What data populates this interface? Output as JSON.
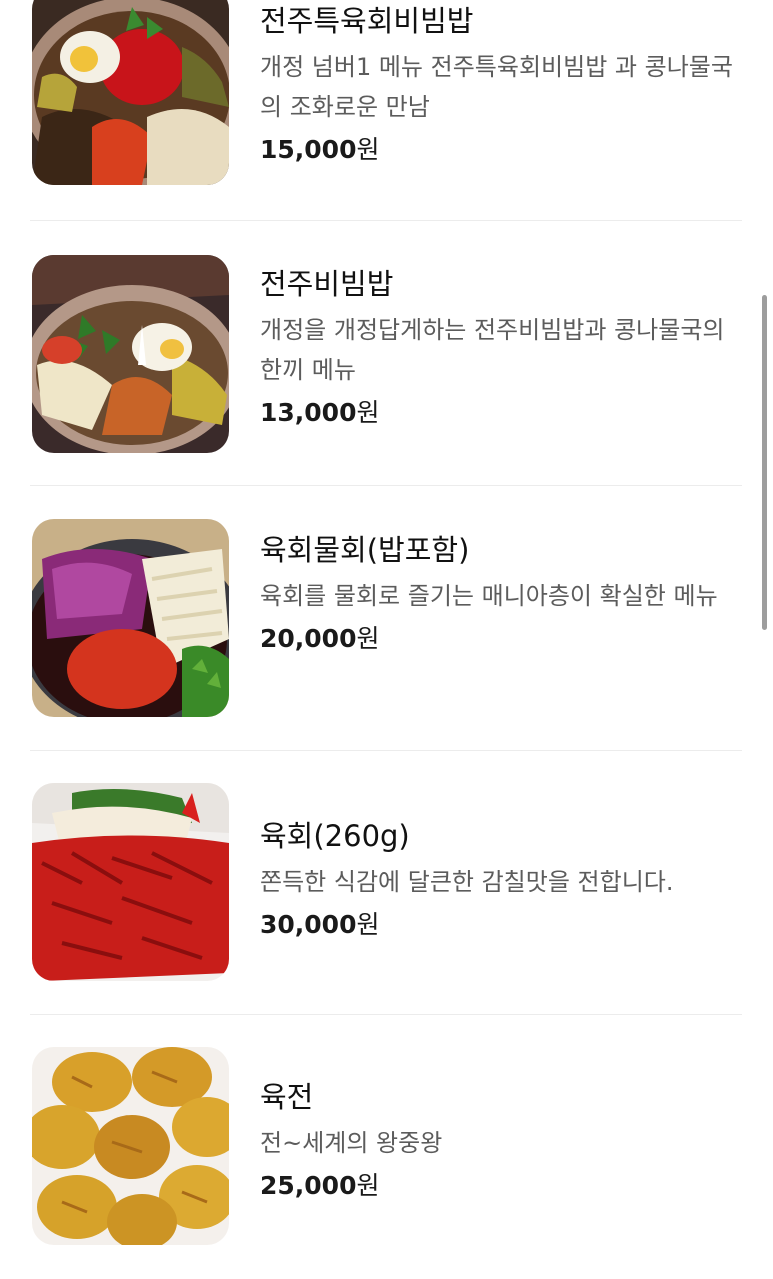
{
  "menu": {
    "items": [
      {
        "name": "전주특육회비빔밥",
        "description": "개정 넘버1 메뉴 전주특육회비빔밥 과 콩나물국의 조화로운 만남",
        "price": "15,000",
        "currency": "원",
        "image_icon": "bibimbap-photo"
      },
      {
        "name": "전주비빔밥",
        "description": "개정을 개정답게하는 전주비빔밥과 콩나물국의 한끼 메뉴",
        "price": "13,000",
        "currency": "원",
        "image_icon": "bibimbap-photo"
      },
      {
        "name": "육회물회(밥포함)",
        "description": "육회를 물회로 즐기는 매니아층이 확실한 메뉴",
        "price": "20,000",
        "currency": "원",
        "image_icon": "mulhoe-photo"
      },
      {
        "name": "육회(260g)",
        "description": "쫀득한 식감에 달큰한 감칠맛을 전합니다.",
        "price": "30,000",
        "currency": "원",
        "image_icon": "yukhoe-photo"
      },
      {
        "name": "육전",
        "description": "전~세계의 왕중왕",
        "price": "25,000",
        "currency": "원",
        "image_icon": "yukjeon-photo"
      }
    ]
  },
  "colors": {
    "text_primary": "#111111",
    "text_secondary": "#5c5c5c",
    "divider": "#ececec",
    "background": "#ffffff"
  }
}
